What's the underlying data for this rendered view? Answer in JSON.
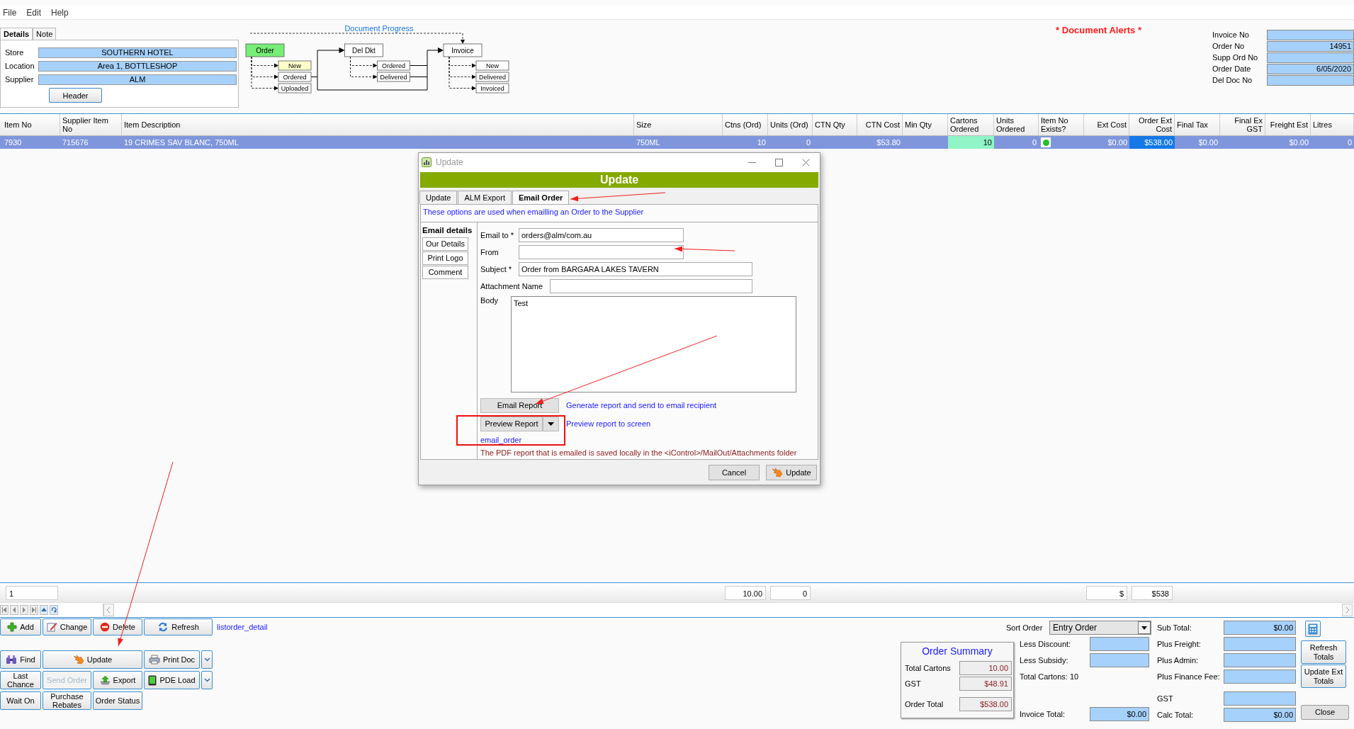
{
  "menu": [
    "File",
    "Edit",
    "Help"
  ],
  "details": {
    "tabs": [
      {
        "label": "Details",
        "selected": true
      },
      {
        "label": "Note",
        "selected": false
      }
    ],
    "fields": [
      {
        "label": "Store",
        "value": "SOUTHERN HOTEL"
      },
      {
        "label": "Location",
        "value": "Area 1, BOTTLESHOP"
      },
      {
        "label": "Supplier",
        "value": "ALM"
      }
    ],
    "button": "Header"
  },
  "document_progress": {
    "title": "Document Progress",
    "stages": [
      {
        "label": "Order",
        "color": "#77ee77",
        "steps": [
          {
            "label": "New",
            "color": "#ffffcc"
          },
          {
            "label": "Ordered",
            "color": "#ffffff"
          },
          {
            "label": "Uploaded",
            "color": "#ffffff"
          }
        ]
      },
      {
        "label": "Del Dkt",
        "color": "#ffffff",
        "steps": [
          {
            "label": "Ordered",
            "color": "#ffffff"
          },
          {
            "label": "Delivered",
            "color": "#ffffff"
          }
        ]
      },
      {
        "label": "Invoice",
        "color": "#ffffff",
        "steps": [
          {
            "label": "New",
            "color": "#ffffff"
          },
          {
            "label": "Delivered",
            "color": "#ffffff"
          },
          {
            "label": "Invoiced",
            "color": "#ffffff"
          }
        ]
      }
    ]
  },
  "document_alerts": "* Document Alerts *",
  "document_fields": [
    {
      "label": "Invoice No"
    },
    {
      "label": "Order No",
      "value": "14951"
    },
    {
      "label": "Supp Ord No"
    },
    {
      "label": "Order Date",
      "value": "6/05/2020"
    },
    {
      "label": "Del Doc No"
    }
  ],
  "table": {
    "columns": [
      "Item No",
      "Supplier Item No",
      "Item Description",
      "Size",
      "Ctns (Ord)",
      "Units (Ord)",
      "CTN Qty",
      "CTN Cost",
      "Min Qty",
      "Cartons Ordered",
      "Units Ordered",
      "Item No Exists?",
      "Ext Cost",
      "Order Ext Cost",
      "Final Tax",
      "Final Ex GST",
      "Freight Est",
      "Litres"
    ],
    "rows": [
      {
        "selected": true,
        "cells": [
          {
            "kind": "text",
            "text": "7930",
            "editing": false,
            "focused": false
          },
          {
            "kind": "text",
            "text": "715676",
            "editing": false,
            "focused": false
          },
          {
            "kind": "text",
            "text": "19 CRIMES SAV BLANC, 750ML",
            "editing": false,
            "focused": false
          },
          {
            "kind": "text",
            "text": "750ML",
            "editing": false,
            "focused": false
          },
          {
            "kind": "text",
            "text": "10",
            "editing": false,
            "focused": false
          },
          {
            "kind": "text",
            "text": "0",
            "editing": false,
            "focused": false
          },
          {
            "kind": "empty"
          },
          {
            "kind": "text",
            "text": "$53.80",
            "editing": false,
            "focused": false
          },
          {
            "kind": "empty"
          },
          {
            "kind": "text",
            "text": "10",
            "editing": true,
            "focused": false
          },
          {
            "kind": "text",
            "text": "0",
            "editing": false,
            "focused": false
          },
          {
            "kind": "indicator",
            "on": true
          },
          {
            "kind": "text",
            "text": "$0.00",
            "editing": false,
            "focused": false
          },
          {
            "kind": "text",
            "text": "$538.00",
            "editing": false,
            "focused": true
          },
          {
            "kind": "text",
            "text": "$0.00",
            "editing": false,
            "focused": false
          },
          {
            "kind": "empty"
          },
          {
            "kind": "text",
            "text": "$0.00",
            "editing": false,
            "focused": false
          },
          {
            "kind": "text",
            "text": "0",
            "editing": false,
            "focused": false
          }
        ]
      }
    ],
    "totals": [
      {
        "kind": "field",
        "text": "1"
      },
      {
        "kind": "empty"
      },
      {
        "kind": "empty"
      },
      {
        "kind": "empty"
      },
      {
        "kind": "field",
        "text": "10.00"
      },
      {
        "kind": "field",
        "text": "0"
      },
      {
        "kind": "empty"
      },
      {
        "kind": "empty"
      },
      {
        "kind": "empty"
      },
      {
        "kind": "empty"
      },
      {
        "kind": "empty"
      },
      {
        "kind": "empty"
      },
      {
        "kind": "field",
        "text": "$"
      },
      {
        "kind": "field",
        "text": "$538"
      },
      {
        "kind": "empty"
      },
      {
        "kind": "empty"
      },
      {
        "kind": "empty"
      },
      {
        "kind": "empty"
      }
    ]
  },
  "actions": {
    "buttons": [
      {
        "label": "Add",
        "disabled": false,
        "has_menu": false
      },
      {
        "label": "Change",
        "disabled": false,
        "has_menu": false
      },
      {
        "label": "Delete",
        "disabled": false,
        "has_menu": false
      },
      {
        "label": "Refresh",
        "disabled": false,
        "has_menu": false
      },
      {
        "label": "Find",
        "disabled": false,
        "has_menu": false
      },
      {
        "label": "Update",
        "disabled": false,
        "has_menu": false
      },
      {
        "label": "Print Doc",
        "disabled": false,
        "has_menu": true
      },
      {
        "label": "Last Chance",
        "disabled": false,
        "has_menu": false
      },
      {
        "label": "Send Order",
        "disabled": true,
        "has_menu": false
      },
      {
        "label": "Export",
        "disabled": false,
        "has_menu": false
      },
      {
        "label": "PDE Load",
        "disabled": false,
        "has_menu": true
      },
      {
        "label": "Wait On",
        "disabled": false,
        "has_menu": false
      },
      {
        "label": "Purchase Rebates",
        "disabled": false,
        "has_menu": false
      },
      {
        "label": "Order Status",
        "disabled": false,
        "has_menu": false
      }
    ],
    "link": "listorder_detail"
  },
  "sort_order": {
    "label": "Sort Order",
    "value": "Entry Order"
  },
  "order_summary": {
    "title": "Order Summary",
    "rows": [
      {
        "label": "Total Cartons",
        "value": "10.00"
      },
      {
        "label": "GST",
        "value": "$48.91"
      },
      {
        "label": "Order Total",
        "value": "$538.00"
      }
    ]
  },
  "adjustments": [
    {
      "label": "Less Discount:"
    },
    {
      "label": "Less Subsidy:"
    }
  ],
  "total_cartons": "Total Cartons: 10",
  "invoice_total": {
    "label": "Invoice Total:",
    "value": "$0.00"
  },
  "totals": [
    {
      "label": "Sub Total:",
      "value": "$0.00"
    },
    {
      "label": "Plus Freight:"
    },
    {
      "label": "Plus Admin:"
    },
    {
      "label": "Plus Finance Fee:"
    },
    {
      "label": "GST"
    },
    {
      "label": "Calc Total:",
      "value": "$0.00"
    }
  ],
  "total_buttons": [
    "Refresh Totals",
    "Update Ext Totals",
    "Close"
  ],
  "dialog": {
    "title": "Update",
    "heading": "Update",
    "tabs": [
      {
        "label": "Update",
        "selected": false
      },
      {
        "label": "ALM Export",
        "selected": false
      },
      {
        "label": "Email Order",
        "selected": true
      }
    ],
    "info": "These options are used when emailling an Order to the Supplier",
    "sections": [
      {
        "label": "Email details",
        "selected": true
      },
      {
        "label": "Our Details",
        "selected": false
      },
      {
        "label": "Print Logo",
        "selected": false
      },
      {
        "label": "Comment",
        "selected": false
      }
    ],
    "fields": [
      {
        "label": "Email to *",
        "value": "orders@alm/com.au",
        "kind": "line"
      },
      {
        "label": "From",
        "kind": "line"
      },
      {
        "label": "Subject *",
        "value": "Order from BARGARA LAKES TAVERN",
        "kind": "line"
      },
      {
        "label": "Attachment Name",
        "kind": "line"
      },
      {
        "label": "Body",
        "value": "Test",
        "kind": "multiline"
      }
    ],
    "actions": [
      {
        "label": "Email Report",
        "description": "Generate report and send to email recipient",
        "has_menu": false
      },
      {
        "label": "Preview Report",
        "description": "Preview report to screen",
        "has_menu": true
      }
    ],
    "report_name": "email_order",
    "note": "The PDF report that is emailed is saved locally in the <iControl>/MailOut/Attachments folder",
    "buttons": [
      "Cancel",
      "Update"
    ]
  }
}
